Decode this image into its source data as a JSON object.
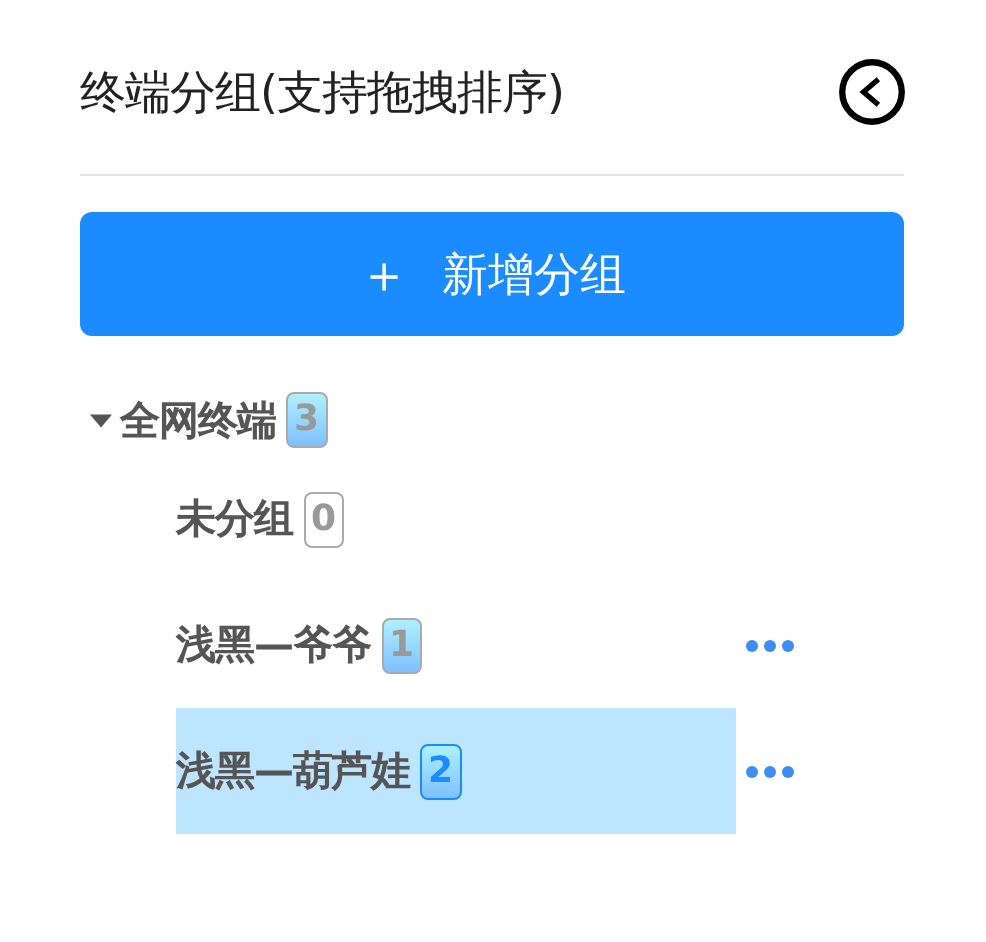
{
  "header": {
    "title": "终端分组(支持拖拽排序)"
  },
  "add_button": {
    "icon": "＋",
    "label": "新增分组"
  },
  "tree": [
    {
      "label": "全网终端",
      "count": "3",
      "kind": "gradient",
      "expanded": true,
      "selected": false,
      "has_menu": false,
      "children": [
        {
          "label": "未分组",
          "count": "0",
          "kind": "plain",
          "selected": false,
          "has_menu": false
        },
        {
          "label": "浅黑—爷爷",
          "count": "1",
          "kind": "gradient",
          "selected": false,
          "has_menu": true
        },
        {
          "label": "浅黑—葫芦娃",
          "count": "2",
          "kind": "gradient",
          "selected": true,
          "has_menu": true
        }
      ]
    }
  ]
}
